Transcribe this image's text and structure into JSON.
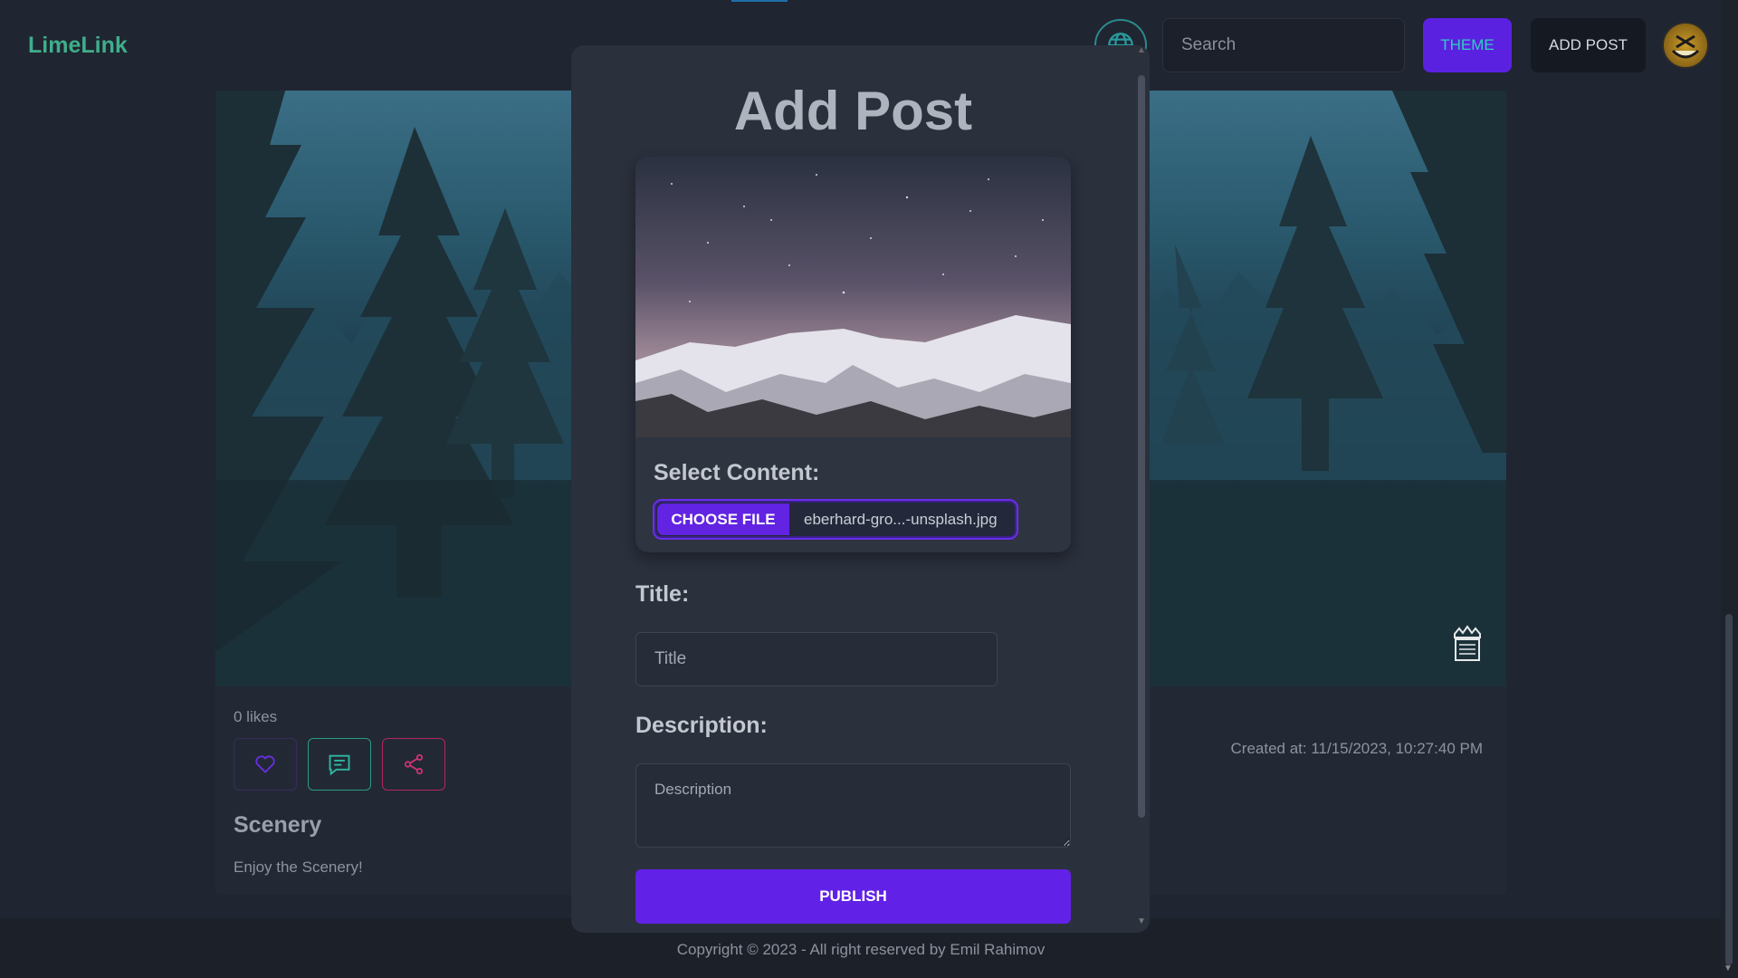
{
  "navbar": {
    "brand": "LimeLink",
    "search_placeholder": "Search",
    "theme_label": "THEME",
    "add_post_label": "ADD POST",
    "icons": [
      "globe-icon",
      "avatar"
    ],
    "colors": {
      "brand": "#3fae8a",
      "theme_bg": "#5b21e0",
      "theme_text": "#2fd0c0"
    }
  },
  "post": {
    "likes": "0 likes",
    "title": "Scenery",
    "description": "Enjoy the Scenery!",
    "created_at": "Created at: 11/15/2023, 10:27:40 PM",
    "actions": [
      "heart-icon",
      "comment-icon",
      "share-icon"
    ]
  },
  "modal": {
    "title": "Add Post",
    "select_content_label": "Select Content:",
    "choose_file_label": "CHOOSE FILE",
    "file_name": "eberhard-gro...-unsplash.jpg",
    "title_label": "Title:",
    "title_placeholder": "Title",
    "description_label": "Description:",
    "description_placeholder": "Description",
    "publish_label": "PUBLISH",
    "accent_color": "#6221e6"
  },
  "footer": {
    "copyright": "Copyright © 2023 - All right reserved by Emil Rahimov"
  }
}
